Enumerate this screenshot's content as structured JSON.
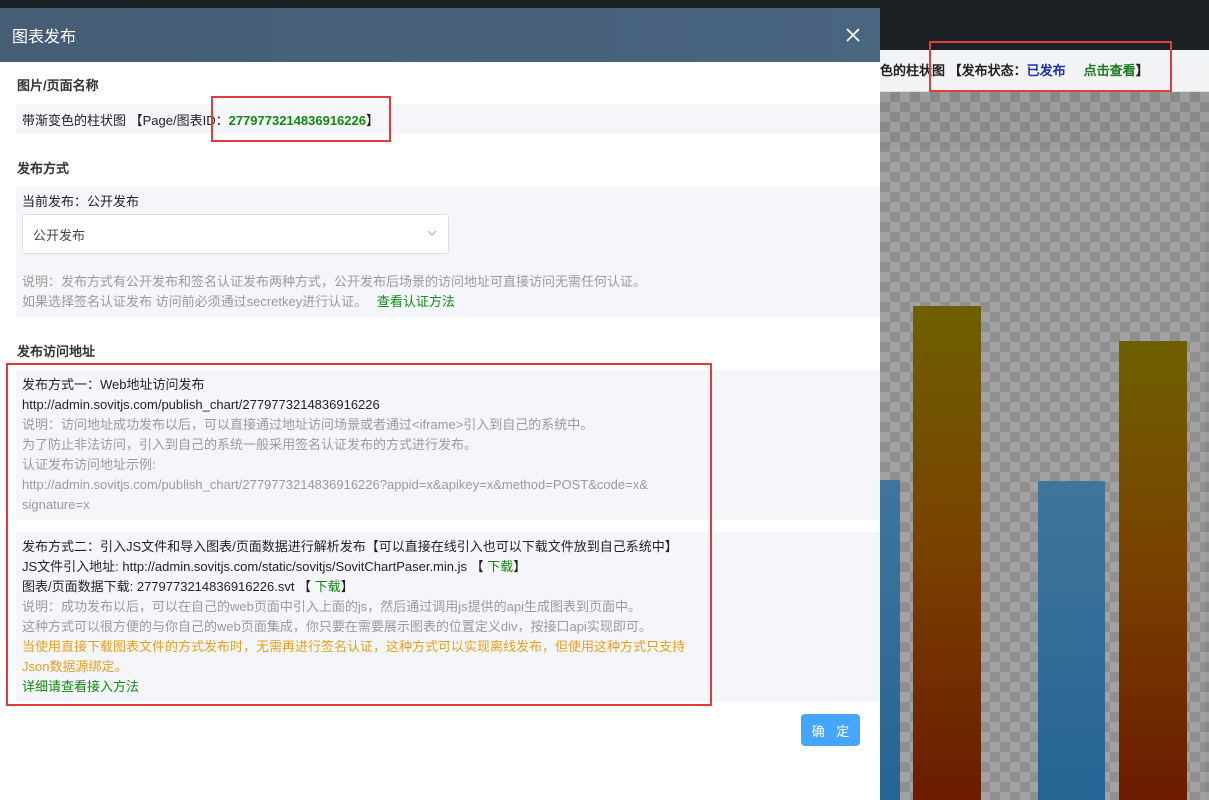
{
  "background": {
    "infobar_prefix": "色的柱状图 【发布状态：",
    "status_value": "已发布",
    "view_link": "点击查看",
    "suffix": "】"
  },
  "dialog": {
    "title": "图表发布",
    "name_section": {
      "title": "图片/页面名称",
      "name_prefix": "带渐变色的柱状图 【Page/图表ID：",
      "chart_id": "2779773214836916226",
      "name_suffix": "】"
    },
    "method_section": {
      "title": "发布方式",
      "current_label": "当前发布：公开发布",
      "select_value": "公开发布",
      "desc_line1": "说明：发布方式有公开发布和签名认证发布两种方式，公开发布后场景的访问地址可直接访问无需任何认证。",
      "desc_line2": "如果选择签名认证发布 访问前必须通过secretkey进行认证。",
      "auth_link": "查看认证方法"
    },
    "address_section": {
      "title": "发布访问地址",
      "method1_title": "发布方式一：Web地址访问发布",
      "method1_url": "http://admin.sovitjs.com/publish_chart/2779773214836916226",
      "method1_desc1": "说明：访问地址成功发布以后，可以直接通过地址访问场景或者通过<iframe>引入到自己的系统中。",
      "method1_desc2": "为了防止非法访问，引入到自己的系统一般采用签名认证发布的方式进行发布。",
      "method1_desc3": "认证发布访问地址示例:",
      "method1_example1": "http://admin.sovitjs.com/publish_chart/2779773214836916226?appid=x&apikey=x&method=POST&code=x&",
      "method1_example2": "signature=x",
      "method2_title": "发布方式二：引入JS文件和导入图表/页面数据进行解析发布【可以直接在线引入也可以下载文件放到自己系统中】",
      "js_label": "JS文件引入地址:  http://admin.sovitjs.com/static/sovitjs/SovitChartPaser.min.js 【",
      "js_download": "下载",
      "js_suffix": "】",
      "data_label": "图表/页面数据下载:  2779773214836916226.svt 【",
      "data_download": "下载",
      "data_suffix": "】",
      "method2_desc1": "说明：成功发布以后，可以在自己的web页面中引入上面的js，然后通过调用js提供的api生成图表到页面中。",
      "method2_desc2": "这种方式可以很方便的与你自己的web页面集成，你只要在需要展示图表的位置定义div，按接口api实现即可。",
      "warn_line1": "当使用直接下载图表文件的方式发布时，无需再进行签名认证，这种方式可以实现离线发布，但使用这种方式只支持",
      "warn_line2": "Json数据源绑定。",
      "detail_link": "详细请查看接入方法"
    },
    "confirm_label": "确 定"
  },
  "colors": {
    "header_bg": "#455d75",
    "confirm_bg": "#46a6ff",
    "highlight_red": "#e23b3b",
    "link_green": "#118811",
    "warning_orange": "#e6a020"
  }
}
